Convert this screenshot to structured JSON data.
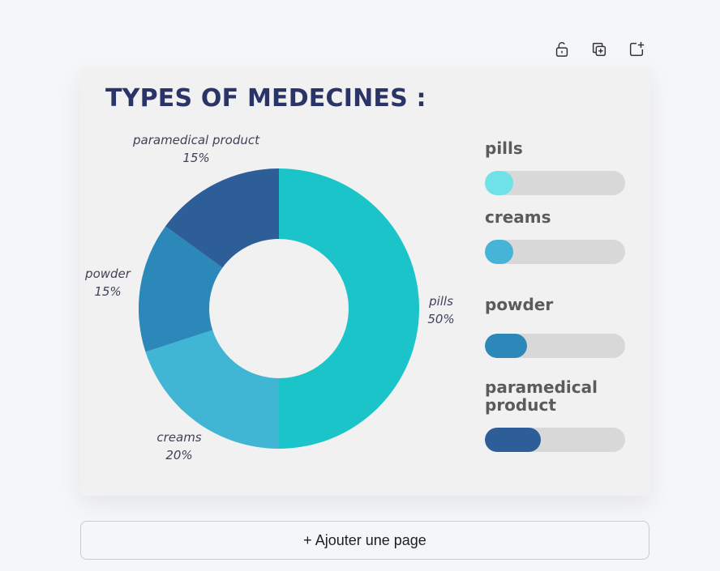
{
  "page": {
    "add_page_label": "+ Ajouter une page"
  },
  "toolbar": {
    "items": [
      {
        "icon": "unlock-icon"
      },
      {
        "icon": "duplicate-icon"
      },
      {
        "icon": "add-page-icon"
      }
    ]
  },
  "chart_data": {
    "type": "pie",
    "donut": true,
    "title": "TYPES OF MEDECINES :",
    "slices": [
      {
        "name": "pills",
        "label": "pills",
        "value_label": "50%",
        "value": 50,
        "color": "#1bc4c8"
      },
      {
        "name": "creams",
        "label": "creams",
        "value_label": "20%",
        "value": 20,
        "color": "#41b5d4"
      },
      {
        "name": "powder",
        "label": "powder",
        "value_label": "15%",
        "value": 15,
        "color": "#2c88b9"
      },
      {
        "name": "paramedical product",
        "label": "paramedical product",
        "value_label": "15%",
        "value": 15,
        "color": "#2d5e98"
      }
    ],
    "legend": {
      "placement": "right",
      "items": [
        {
          "label": "pills",
          "level": 0.2,
          "color": "#6fe2e8"
        },
        {
          "label": "creams",
          "level": 0.2,
          "color": "#45b4d6"
        },
        {
          "label": "powder",
          "level": 0.3,
          "color": "#2c88b9"
        },
        {
          "label": "paramedical product",
          "level": 0.4,
          "color": "#2d5e98"
        }
      ]
    }
  }
}
